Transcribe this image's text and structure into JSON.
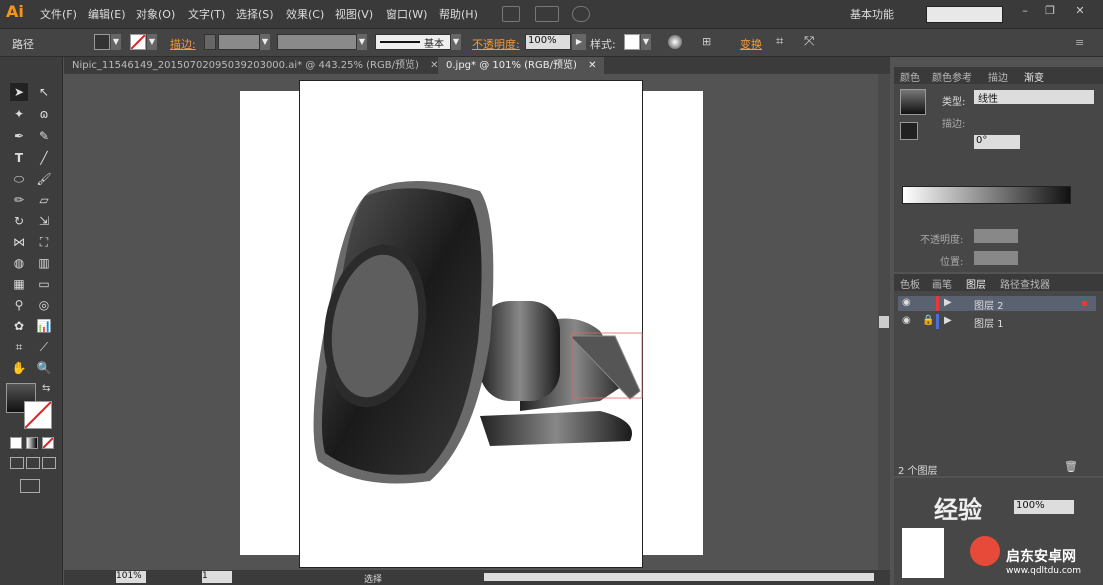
{
  "app": {
    "logo": "Ai"
  },
  "menu": [
    "文件(F)",
    "编辑(E)",
    "对象(O)",
    "文字(T)",
    "选择(S)",
    "效果(C)",
    "视图(V)",
    "窗口(W)",
    "帮助(H)"
  ],
  "workspace": "基本功能",
  "window_controls": [
    "–",
    "❐",
    "✕"
  ],
  "control_bar": {
    "selection_label": "路径",
    "stroke_label": "描边:",
    "stroke_style": "基本",
    "opacity_label": "不透明度:",
    "opacity_value": "100%",
    "style_label": "样式:",
    "transform_label": "变换"
  },
  "tabs": [
    {
      "label": "Nipic_11546149_20150702095039203000.ai* @ 443.25% (RGB/预览)",
      "close": "✕"
    },
    {
      "label": "0.jpg* @ 101% (RGB/预览)",
      "close": "✕"
    }
  ],
  "gradient_panel": {
    "tabs": [
      "颜色",
      "颜色参考",
      "描边",
      "渐变"
    ],
    "type_label": "类型:",
    "type_value": "线性",
    "stroke_label": "描边:",
    "angle_value": "0°",
    "opacity_label": "不透明度:",
    "position_label": "位置:"
  },
  "layers_panel": {
    "tabs": [
      "色板",
      "画笔",
      "图层",
      "路径查找器"
    ],
    "layers": [
      {
        "name": "图层 2",
        "color": "#e8383d"
      },
      {
        "name": "图层 1",
        "color": "#4a6fd6"
      }
    ],
    "footer": "2 个图层"
  },
  "bottom_panel": {
    "opacity_value": "100%",
    "watermark": "经验",
    "bottom_text": "启东安卓网",
    "bottom_url": "www.qdltdu.com"
  },
  "status_bar": {
    "zoom": "101%",
    "page": "1",
    "mode": "选择"
  },
  "colors": {
    "accent": "#f39c3a",
    "panel": "#474747",
    "canvas": "#535353"
  }
}
